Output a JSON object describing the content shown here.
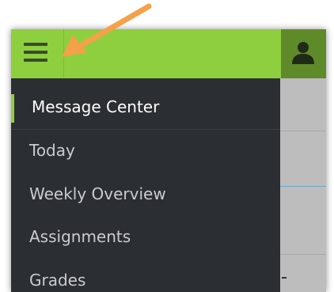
{
  "header": {
    "menu_icon": "hamburger-menu-icon",
    "profile_icon": "person-icon",
    "background_color": "#8ecf3f",
    "profile_color": "#5e8a2a"
  },
  "drawer": {
    "background_color": "#2b2e33",
    "active_indicator_color": "#8ecf3f",
    "items": [
      {
        "label": "Message Center",
        "active": true
      },
      {
        "label": "Today",
        "active": false
      },
      {
        "label": "Weekly Overview",
        "active": false
      },
      {
        "label": "Assignments",
        "active": false
      },
      {
        "label": "Grades",
        "active": false
      }
    ]
  },
  "annotation": {
    "arrow_color": "#f4a14a",
    "points_to": "hamburger-menu-icon"
  }
}
